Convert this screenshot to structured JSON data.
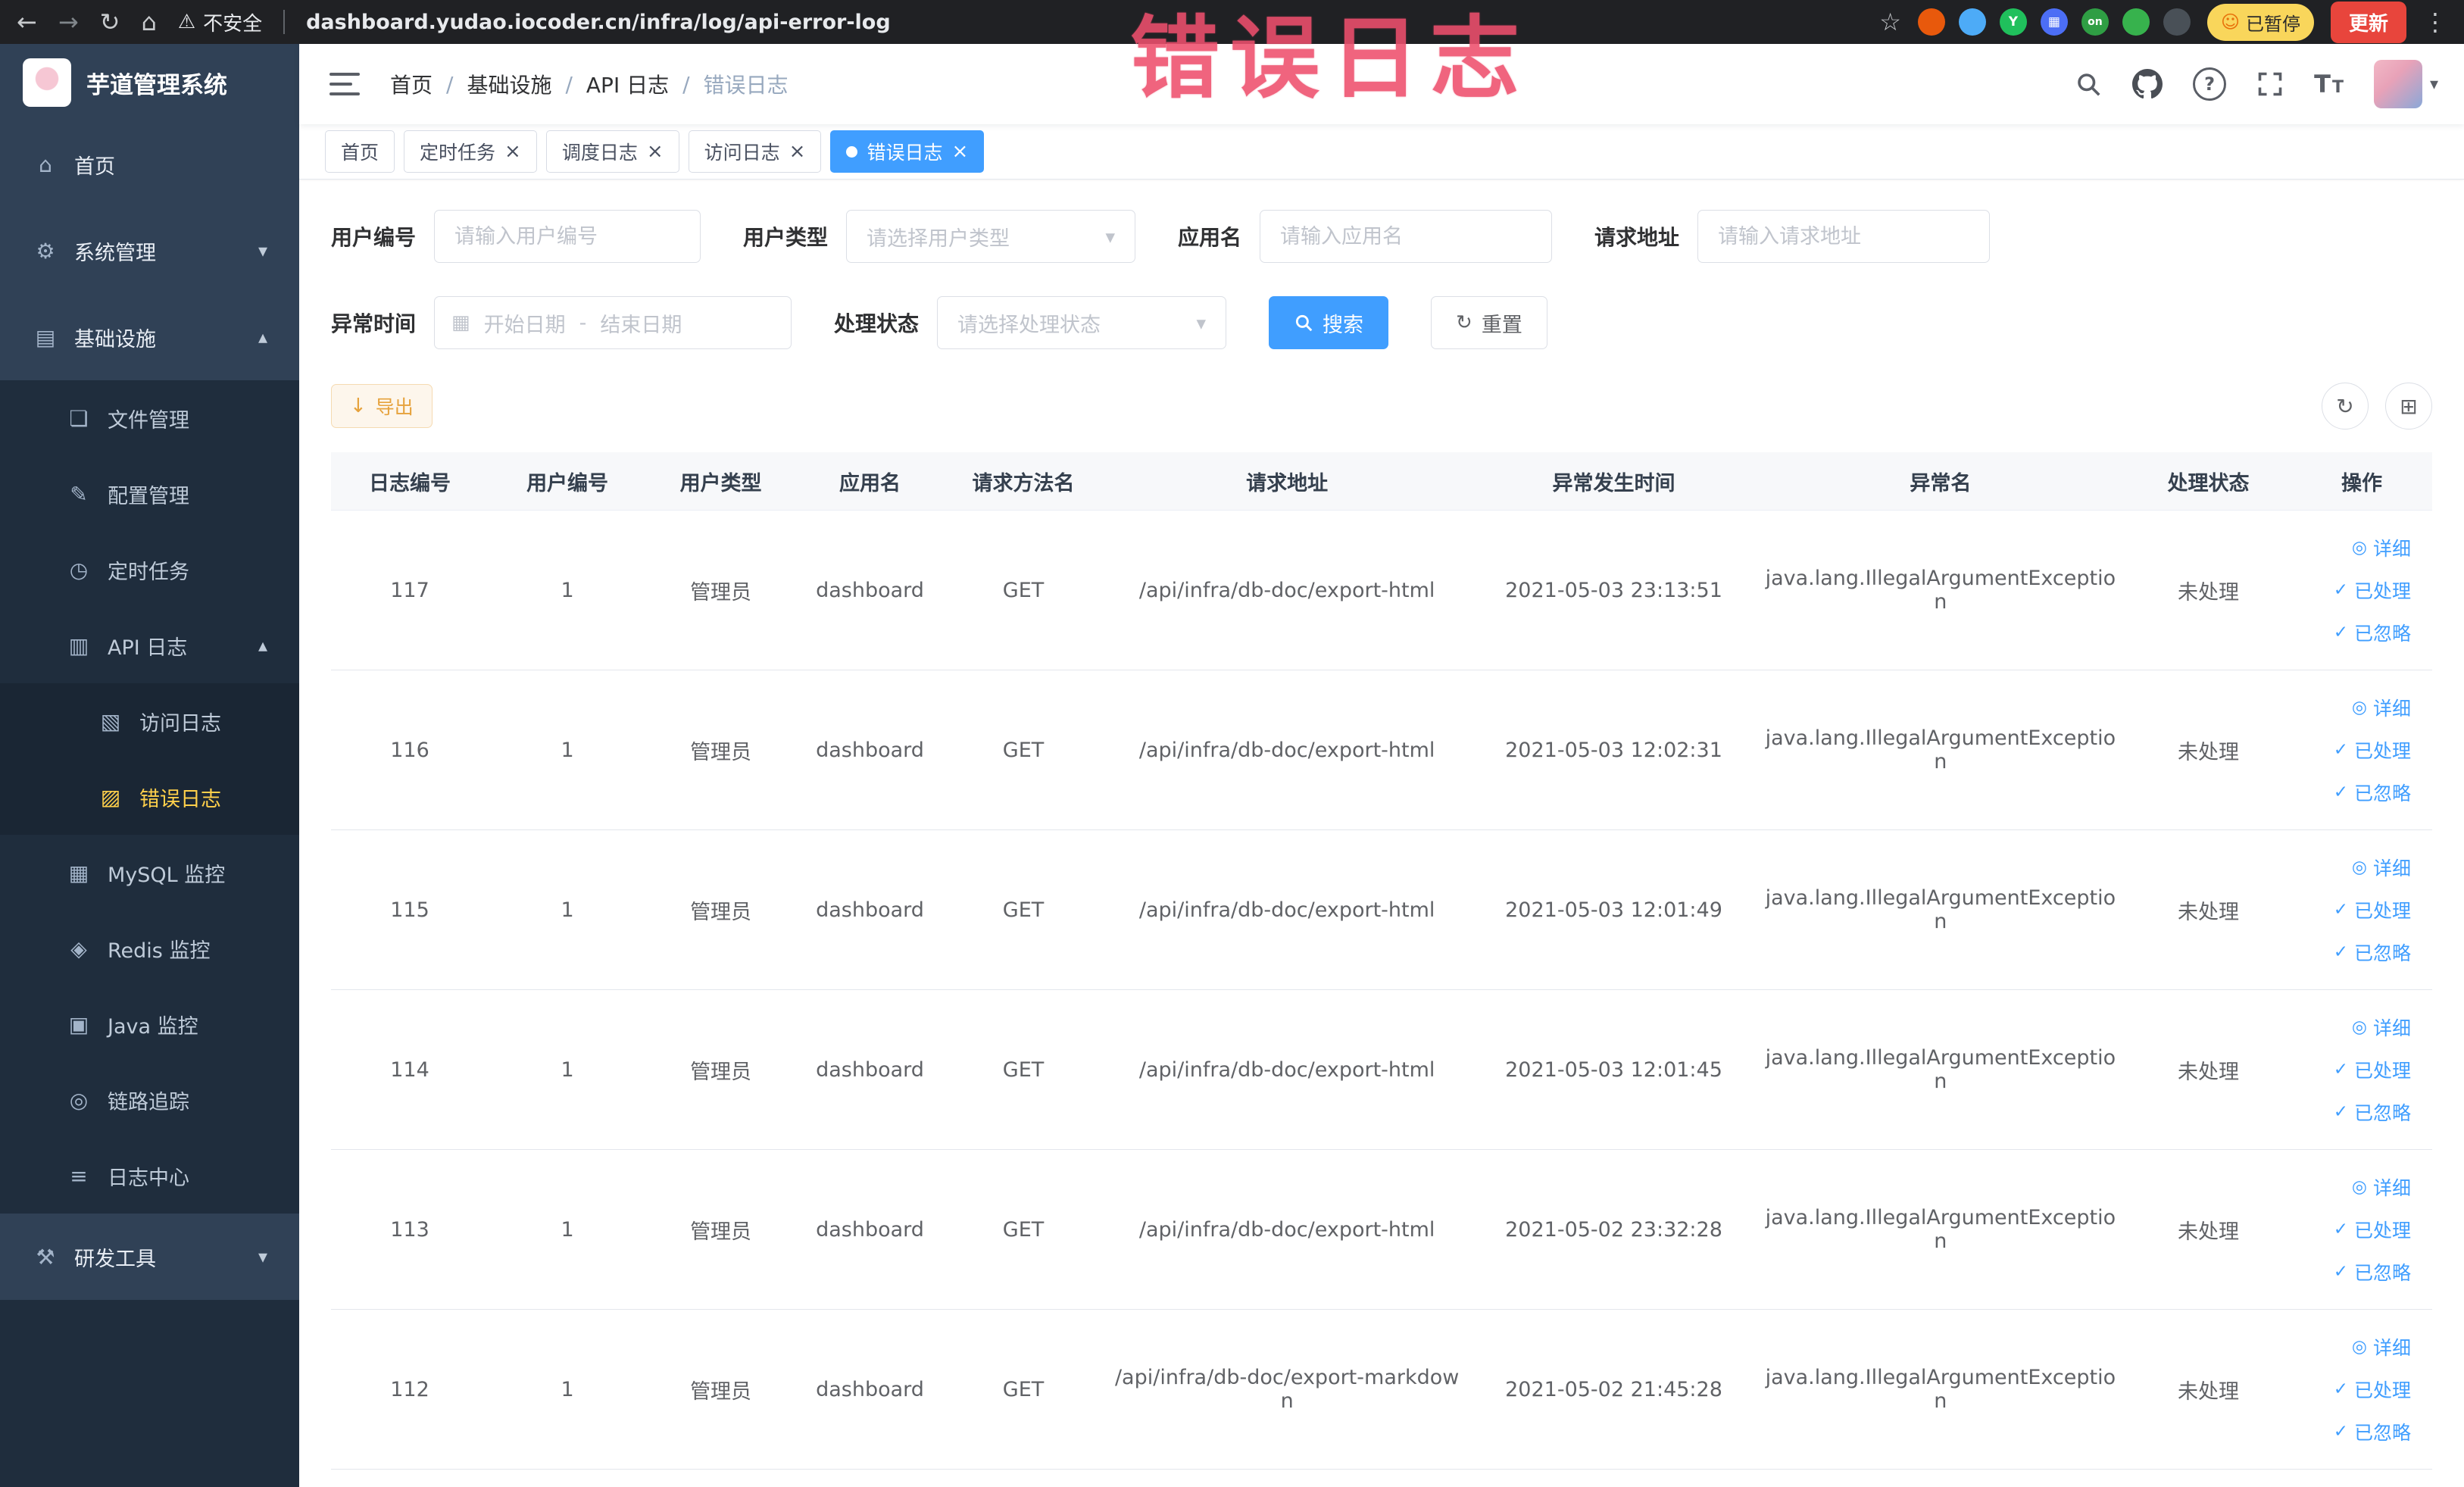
{
  "browser": {
    "security_label": "不安全",
    "url": "dashboard.yudao.iocoder.cn/infra/log/api-error-log",
    "paused_badge": "已暂停",
    "update_label": "更新",
    "extensions": [
      {
        "key": "ext-red-circle",
        "name": "extension-red-circle-icon",
        "color": "#e8590c",
        "glyph": ""
      },
      {
        "key": "ext-blue-drop",
        "name": "extension-blue-drop-icon",
        "color": "#4dabf7",
        "glyph": ""
      },
      {
        "key": "ext-green-y",
        "name": "extension-green-y-icon",
        "color": "#20c05c",
        "glyph": "Y"
      },
      {
        "key": "ext-blue-grid",
        "name": "extension-blue-grid-icon",
        "color": "#4c6ef5",
        "glyph": "▦"
      },
      {
        "key": "ext-on-badge",
        "name": "extension-on-badge-icon",
        "color": "#2f9e44",
        "glyph": "on"
      },
      {
        "key": "ext-green-leaf",
        "name": "extension-green-leaf-icon",
        "color": "#37b24d",
        "glyph": ""
      },
      {
        "key": "ext-dark-paw",
        "name": "extension-paw-icon",
        "color": "#495057",
        "glyph": ""
      }
    ]
  },
  "annotation": {
    "text": "错误日志",
    "color": "#ee4f6d"
  },
  "sidebar": {
    "logo": "芋道管理系统",
    "menu": [
      {
        "key": "home",
        "label": "首页",
        "icon": "home-icon",
        "level": 1
      },
      {
        "key": "system",
        "label": "系统管理",
        "icon": "gear-icon",
        "level": 1,
        "chevron": "down"
      },
      {
        "key": "infra",
        "label": "基础设施",
        "icon": "infra-icon",
        "level": 1,
        "chevron": "up"
      },
      {
        "key": "file",
        "label": "文件管理",
        "icon": "file-icon",
        "level": 2
      },
      {
        "key": "config",
        "label": "配置管理",
        "icon": "config-icon",
        "level": 2
      },
      {
        "key": "job",
        "label": "定时任务",
        "icon": "timer-icon",
        "level": 2
      },
      {
        "key": "api-log",
        "label": "API 日志",
        "icon": "api-log-icon",
        "level": 2,
        "chevron": "up"
      },
      {
        "key": "access-log",
        "label": "访问日志",
        "icon": "access-log-icon",
        "level": 3
      },
      {
        "key": "error-log",
        "label": "错误日志",
        "icon": "error-log-icon",
        "level": 3,
        "active": true
      },
      {
        "key": "mysql",
        "label": "MySQL 监控",
        "icon": "mysql-icon",
        "level": 2
      },
      {
        "key": "redis",
        "label": "Redis 监控",
        "icon": "redis-icon",
        "level": 2
      },
      {
        "key": "java",
        "label": "Java 监控",
        "icon": "java-icon",
        "level": 2
      },
      {
        "key": "trace",
        "label": "链路追踪",
        "icon": "trace-icon",
        "level": 2
      },
      {
        "key": "log-center",
        "label": "日志中心",
        "icon": "log-center-icon",
        "level": 2
      },
      {
        "key": "dev-tools",
        "label": "研发工具",
        "icon": "tools-icon",
        "level": 1,
        "chevron": "down"
      }
    ]
  },
  "header": {
    "breadcrumb": [
      "首页",
      "基础设施",
      "API 日志",
      "错误日志"
    ]
  },
  "tabs": [
    {
      "key": "home",
      "label": "首页",
      "closable": false,
      "active": false
    },
    {
      "key": "job",
      "label": "定时任务",
      "closable": true,
      "active": false
    },
    {
      "key": "job-log",
      "label": "调度日志",
      "closable": true,
      "active": false
    },
    {
      "key": "access-log",
      "label": "访问日志",
      "closable": true,
      "active": false
    },
    {
      "key": "error-log",
      "label": "错误日志",
      "closable": true,
      "active": true
    }
  ],
  "filters": {
    "user_id": {
      "label": "用户编号",
      "placeholder": "请输入用户编号"
    },
    "user_type": {
      "label": "用户类型",
      "placeholder": "请选择用户类型"
    },
    "app_name": {
      "label": "应用名",
      "placeholder": "请输入应用名"
    },
    "request_url": {
      "label": "请求地址",
      "placeholder": "请输入请求地址"
    },
    "exception_time": {
      "label": "异常时间",
      "start_placeholder": "开始日期",
      "separator": "-",
      "end_placeholder": "结束日期"
    },
    "process_status": {
      "label": "处理状态",
      "placeholder": "请选择处理状态"
    },
    "search_label": "搜索",
    "reset_label": "重置"
  },
  "toolbar": {
    "export_label": "导出"
  },
  "table": {
    "columns": [
      {
        "key": "id",
        "label": "日志编号"
      },
      {
        "key": "user_id",
        "label": "用户编号"
      },
      {
        "key": "user_type",
        "label": "用户类型"
      },
      {
        "key": "app",
        "label": "应用名"
      },
      {
        "key": "method",
        "label": "请求方法名"
      },
      {
        "key": "url",
        "label": "请求地址"
      },
      {
        "key": "time",
        "label": "异常发生时间"
      },
      {
        "key": "exception",
        "label": "异常名"
      },
      {
        "key": "status",
        "label": "处理状态"
      },
      {
        "key": "actions",
        "label": "操作"
      }
    ],
    "actions": [
      {
        "key": "detail",
        "label": "详细",
        "icon": "detail-eye-icon"
      },
      {
        "key": "processed",
        "label": "已处理",
        "icon": "processed-check-icon"
      },
      {
        "key": "ignored",
        "label": "已忽略",
        "icon": "ignored-check-icon"
      }
    ],
    "rows": [
      {
        "id": "117",
        "user_id": "1",
        "user_type": "管理员",
        "app": "dashboard",
        "method": "GET",
        "url": "/api/infra/db-doc/export-html",
        "time": "2021-05-03 23:13:51",
        "exception": "java.lang.IllegalArgumentException",
        "status": "未处理"
      },
      {
        "id": "116",
        "user_id": "1",
        "user_type": "管理员",
        "app": "dashboard",
        "method": "GET",
        "url": "/api/infra/db-doc/export-html",
        "time": "2021-05-03 12:02:31",
        "exception": "java.lang.IllegalArgumentException",
        "status": "未处理"
      },
      {
        "id": "115",
        "user_id": "1",
        "user_type": "管理员",
        "app": "dashboard",
        "method": "GET",
        "url": "/api/infra/db-doc/export-html",
        "time": "2021-05-03 12:01:49",
        "exception": "java.lang.IllegalArgumentException",
        "status": "未处理"
      },
      {
        "id": "114",
        "user_id": "1",
        "user_type": "管理员",
        "app": "dashboard",
        "method": "GET",
        "url": "/api/infra/db-doc/export-html",
        "time": "2021-05-03 12:01:45",
        "exception": "java.lang.IllegalArgumentException",
        "status": "未处理"
      },
      {
        "id": "113",
        "user_id": "1",
        "user_type": "管理员",
        "app": "dashboard",
        "method": "GET",
        "url": "/api/infra/db-doc/export-html",
        "time": "2021-05-02 23:32:28",
        "exception": "java.lang.IllegalArgumentException",
        "status": "未处理"
      },
      {
        "id": "112",
        "user_id": "1",
        "user_type": "管理员",
        "app": "dashboard",
        "method": "GET",
        "url": "/api/infra/db-doc/export-markdown",
        "time": "2021-05-02 21:45:28",
        "exception": "java.lang.IllegalArgumentException",
        "status": "未处理"
      }
    ]
  },
  "colors": {
    "accent": "#409eff",
    "sidebar_active": "#ffd04b",
    "warning": "#e6a23c",
    "annotation": "#ee4f6d"
  }
}
